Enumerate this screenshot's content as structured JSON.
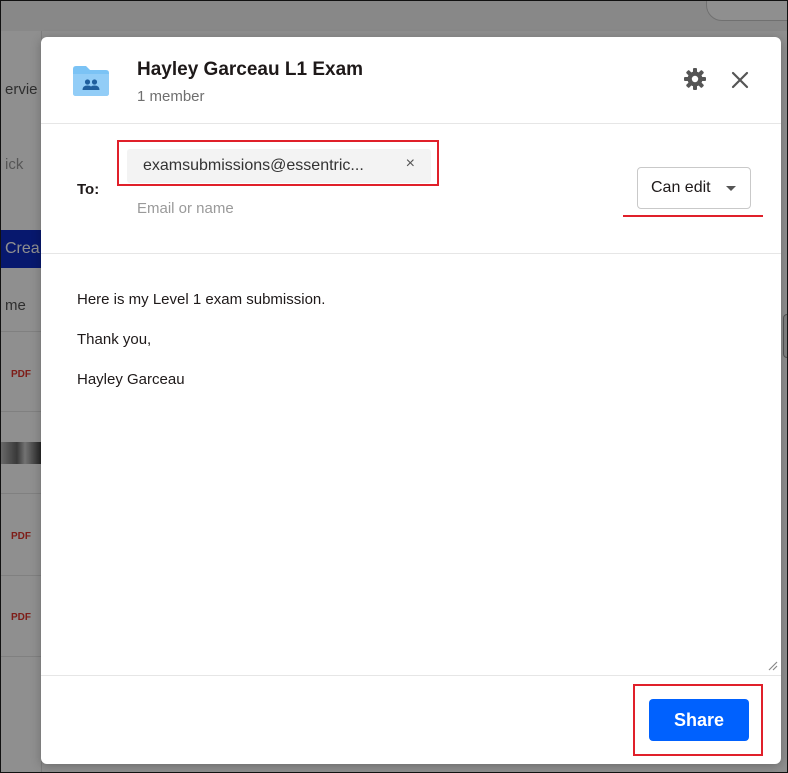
{
  "background": {
    "text_fragments": [
      "ervie",
      "ick",
      "me"
    ],
    "create_label": "Crea",
    "file_badges": [
      "PDF",
      "PDF",
      "PDF"
    ]
  },
  "dialog": {
    "title": "Hayley Garceau L1 Exam",
    "subtitle": "1 member",
    "icons": {
      "folder": "shared-folder-icon",
      "settings": "gear-icon",
      "close": "close-icon"
    },
    "to_label": "To:",
    "recipient_chip": {
      "text": "examsubmissions@essentric...",
      "remove_glyph": "×"
    },
    "email_input": {
      "value": "",
      "placeholder": "Email or name"
    },
    "permission": {
      "selected": "Can edit"
    },
    "message_lines": [
      "Here is my Level 1 exam submission.",
      "Thank you,",
      "Hayley Garceau"
    ],
    "share_label": "Share"
  },
  "colors": {
    "accent": "#0061fe",
    "annotation_red": "#e0202a",
    "folder_blue": "#7bc3f5"
  }
}
